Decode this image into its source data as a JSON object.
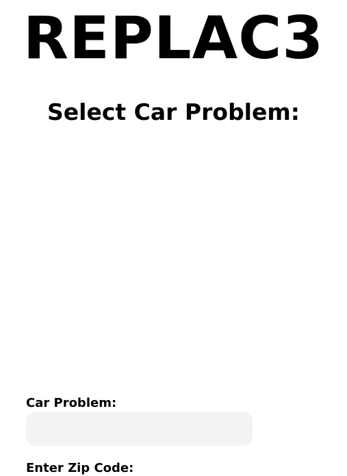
{
  "app": {
    "brand_title": "REPLAC3"
  },
  "main": {
    "section_title": "Select Car Problem:"
  },
  "form": {
    "car_problem_label": "Car Problem:",
    "car_problem_value": "",
    "zip_label": "Enter Zip Code:"
  },
  "colors": {
    "background": "#ffffff",
    "text": "#000000",
    "field_background": "#f3f3f3"
  }
}
